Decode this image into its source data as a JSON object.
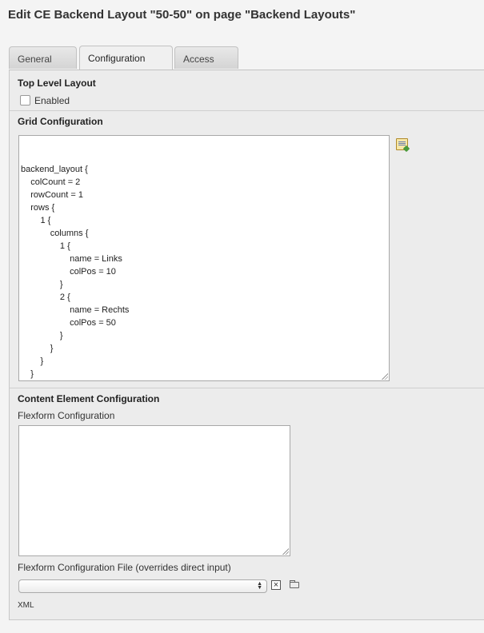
{
  "page": {
    "title": "Edit CE Backend Layout \"50-50\" on page \"Backend Layouts\""
  },
  "tabs": [
    {
      "label": "General",
      "active": false
    },
    {
      "label": "Configuration",
      "active": true
    },
    {
      "label": "Access",
      "active": false
    }
  ],
  "top_level_layout": {
    "title": "Top Level Layout",
    "checkbox_label": "Enabled",
    "checked": false
  },
  "grid_configuration": {
    "title": "Grid Configuration",
    "icon": "wizard-icon",
    "code_lines": [
      "backend_layout {",
      "\tcolCount = 2",
      "\trowCount = 1",
      "\trows {",
      "\t\t1 {",
      "\t\t\tcolumns {",
      "\t\t\t\t1 {",
      "\t\t\t\t\tname = Links",
      "\t\t\t\t\tcolPos = 10",
      "\t\t\t\t}",
      "\t\t\t\t2 {",
      "\t\t\t\t\tname = Rechts",
      "\t\t\t\t\tcolPos = 50",
      "\t\t\t\t}",
      "\t\t\t}",
      "\t\t}",
      "\t}",
      "}"
    ]
  },
  "content_element_configuration": {
    "title": "Content Element Configuration",
    "flexform_label": "Flexform Configuration",
    "flexform_value": "",
    "file_label": "Flexform Configuration File (overrides direct input)",
    "file_selected": "",
    "file_type_note": "XML",
    "clear_icon": "close-icon",
    "browse_icon": "folder-icon"
  }
}
